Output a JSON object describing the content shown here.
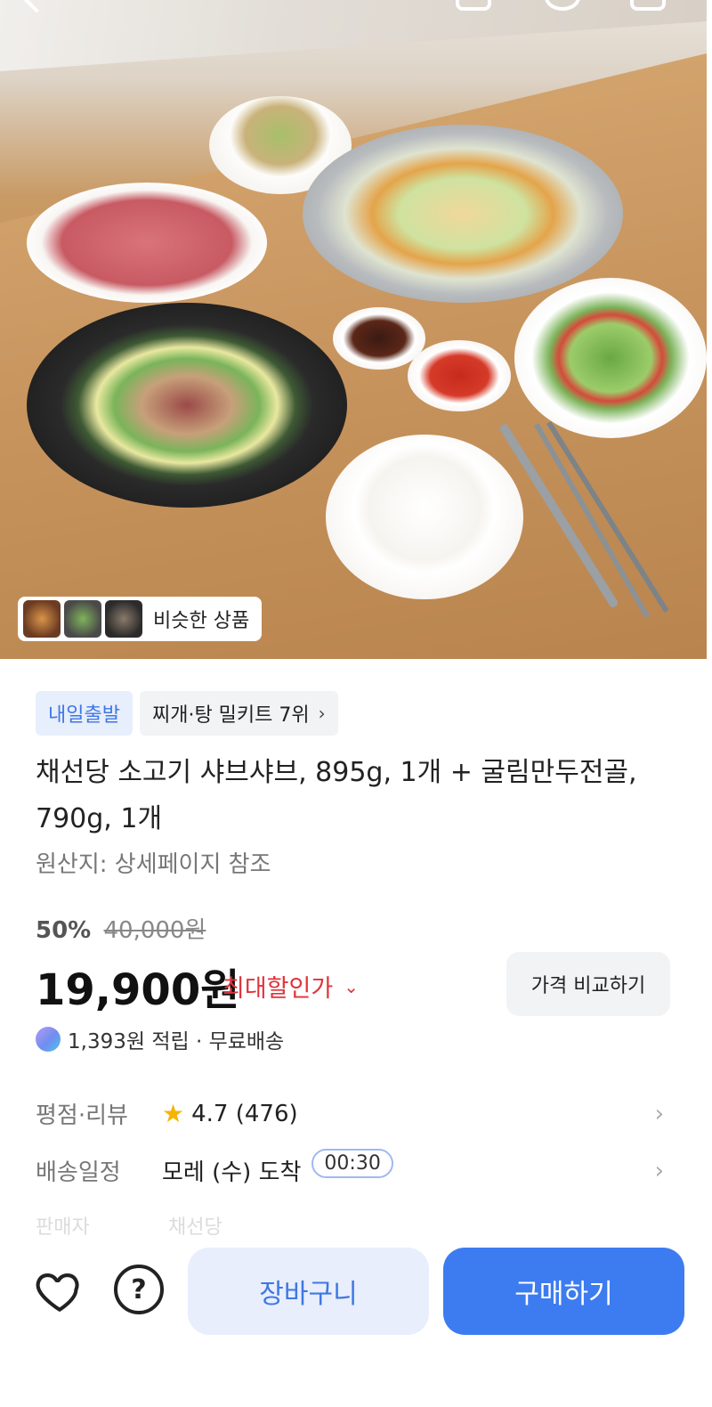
{
  "hero": {
    "image_alt": "샤브샤브 상차림 이미지",
    "similar_label": "비슷한 상품"
  },
  "badges": {
    "delivery": "내일출발",
    "rank": "찌개·탕 밀키트 7위"
  },
  "product": {
    "title": "채선당 소고기 샤브샤브, 895g, 1개 + 굴림만두전골, 790g, 1개",
    "origin": "원산지: 상세페이지 참조"
  },
  "pricing": {
    "discount_percent": "50%",
    "original_price": "40,000원",
    "price": "19,900원",
    "max_discount_label": "최대할인가",
    "compare_button": "가격 비교하기",
    "reward": "1,393원 적립 · 무료배송"
  },
  "details": {
    "rating_key": "평점·리뷰",
    "rating_value": "4.7 (476)",
    "shipping_key": "배송일정",
    "shipping_value": "모레 (수) 도착",
    "timer": "00:30",
    "seller_key": "판매자",
    "seller_value": "채선당"
  },
  "actions": {
    "cart": "장바구니",
    "buy": "구매하기"
  },
  "colors": {
    "accent_blue": "#3d7cf0",
    "discount_red": "#e0333b",
    "star": "#f5b400"
  }
}
